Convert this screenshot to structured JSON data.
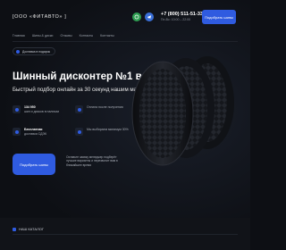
{
  "colors": {
    "accent": "#2f5be0",
    "background": "#0d0f14",
    "whatsapp": "#2e9e52",
    "telegram": "#3a6fd8"
  },
  "header": {
    "logo": "[ООО «ФИТАВТО» ]",
    "icons": [
      "whatsapp-icon",
      "telegram-icon"
    ],
    "phone": "+7 (800) 511-51-33",
    "hours": "Пн-Вс: 10:00 – 22:00",
    "call_button": "Подобрать шины"
  },
  "nav": [
    "Главная",
    "Шины & диски",
    "Отзывы",
    "Контакты",
    "Контакты"
  ],
  "hero": {
    "badge": "Доставка в подарок",
    "title": "Шинный дисконтер №1 в РФ",
    "subtitle": "Быстрый подбор онлайн за 30 секунд нашим мастером!",
    "features": [
      {
        "strong": "134 950",
        "text": "шин и дисков в наличии"
      },
      {
        "strong": "",
        "text": "Оплата после получения"
      },
      {
        "strong": "Бесплатная",
        "text": "доставка СДЭК"
      },
      {
        "strong": "",
        "text": "Мы выбираем минимум 30%"
      }
    ],
    "cta_button": "Подобрать шины",
    "cta_note": "Оставьте заявку менеджер подберёт лучшие варианты и перезвонит вам в ближайшее время"
  },
  "bottom": {
    "label": "НАШ КАТАЛОГ"
  }
}
